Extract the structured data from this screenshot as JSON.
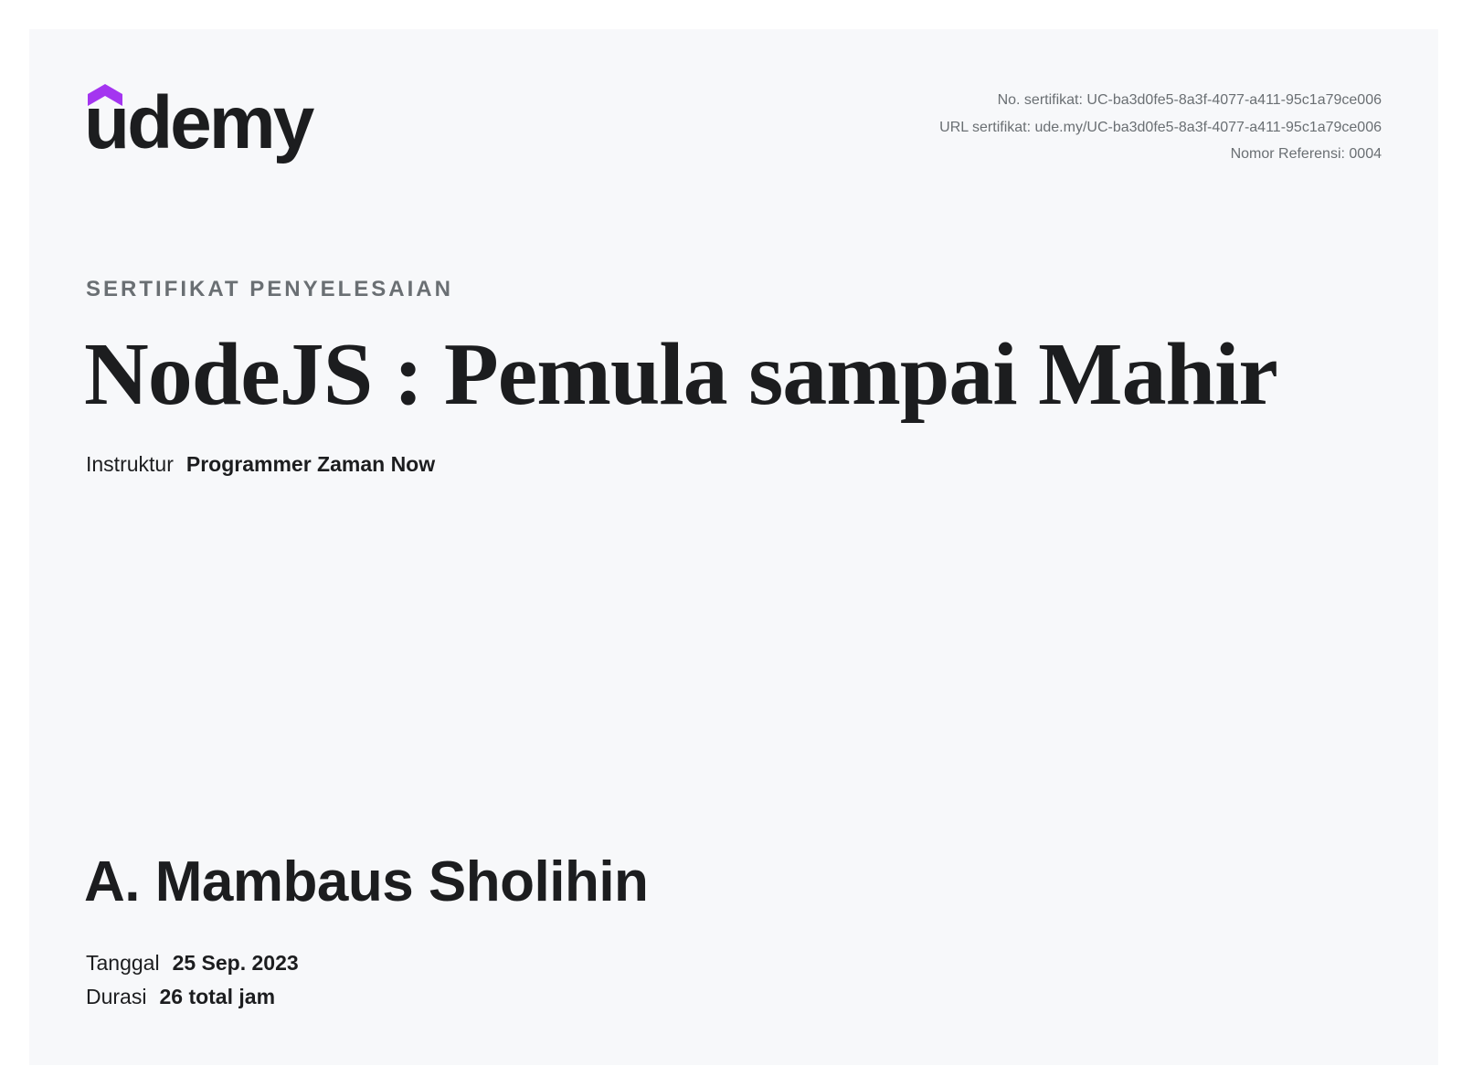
{
  "brand": {
    "name": "udemy",
    "accent_color": "#a435f0",
    "logo_icon": "graduation-cap-icon"
  },
  "certificate_meta": {
    "number": "No. sertifikat: UC-ba3d0fe5-8a3f-4077-a411-95c1a79ce006",
    "url": "URL sertifikat: ude.my/UC-ba3d0fe5-8a3f-4077-a411-95c1a79ce006",
    "reference": "Nomor Referensi: 0004"
  },
  "heading": {
    "eyebrow": "SERTIFIKAT PENYELESAIAN",
    "course_title": "NodeJS : Pemula sampai Mahir"
  },
  "instructor": {
    "label": "Instruktur",
    "name": "Programmer Zaman Now"
  },
  "student": {
    "name": "A. Mambaus Sholihin"
  },
  "details": {
    "date_label": "Tanggal",
    "date_value": "25 Sep. 2023",
    "duration_label": "Durasi",
    "duration_value": "26 total jam"
  }
}
